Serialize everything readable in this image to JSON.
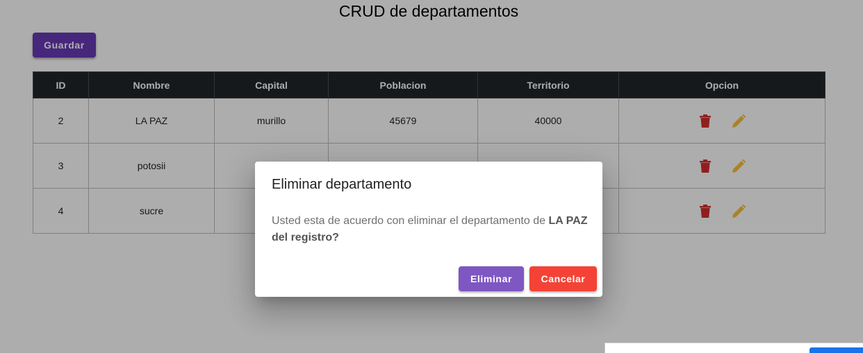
{
  "page": {
    "title": "CRUD de departamentos",
    "save_label": "Guardar"
  },
  "table": {
    "headers": [
      "ID",
      "Nombre",
      "Capital",
      "Poblacion",
      "Territorio",
      "Opcion"
    ],
    "rows": [
      {
        "id": "2",
        "nombre": "LA PAZ",
        "capital": "murillo",
        "poblacion": "45679",
        "territorio": "40000"
      },
      {
        "id": "3",
        "nombre": "potosii",
        "capital": "",
        "poblacion": "",
        "territorio": ""
      },
      {
        "id": "4",
        "nombre": "sucre",
        "capital": "",
        "poblacion": "",
        "territorio": ""
      }
    ]
  },
  "dialog": {
    "title": "Eliminar departamento",
    "text_prefix": "Usted esta de acuerdo con eliminar el departamento de ",
    "text_bold": "LA PAZ del registro?",
    "confirm_label": "Eliminar",
    "cancel_label": "Cancelar"
  },
  "icons": {
    "delete": "trash-icon",
    "edit": "pencil-icon"
  },
  "colors": {
    "primary": "#673ab7",
    "dialog_confirm": "#7e57c2",
    "danger": "#f44336",
    "delete_icon": "#d32f2f",
    "edit_icon": "#f9c23c",
    "header_bg": "#212529"
  }
}
